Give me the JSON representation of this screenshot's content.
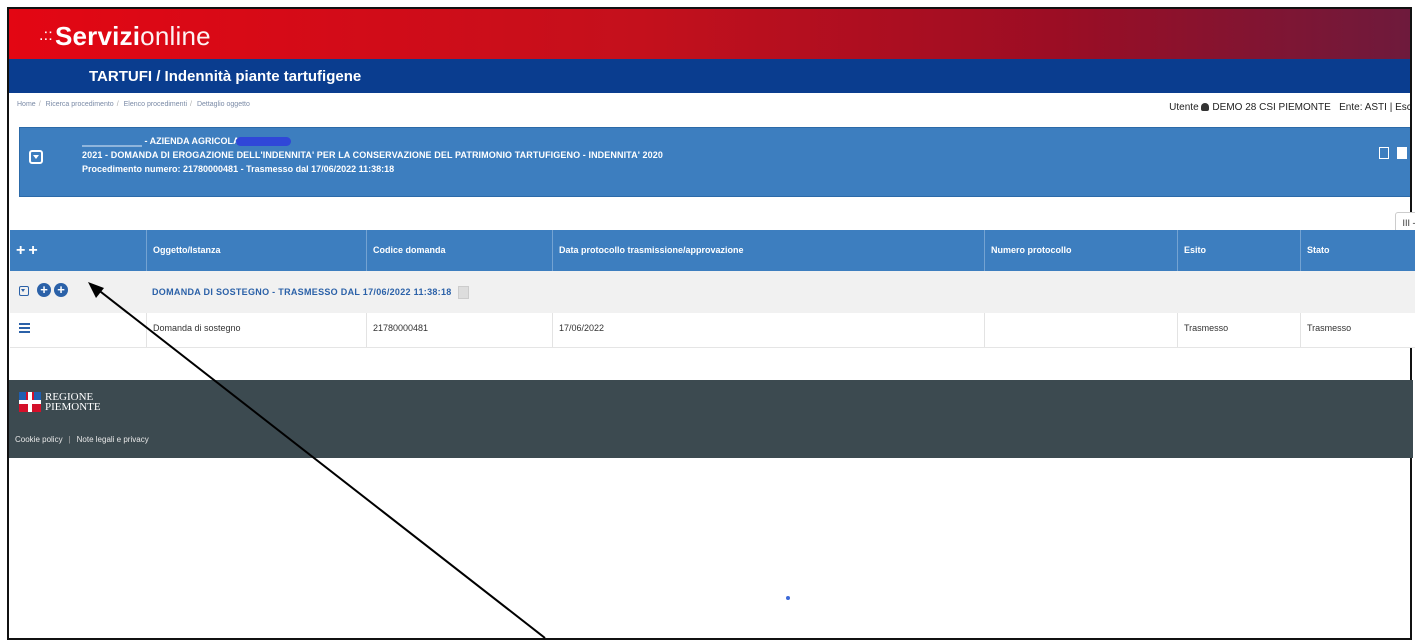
{
  "brand": {
    "dots": ".::",
    "bold": "Servizi",
    "light": "online"
  },
  "header": {
    "subtitle": "TARTUFI / Indennità piante tartufigene"
  },
  "breadcrumb": [
    "Home",
    "Ricerca procedimento",
    "Elenco procedimenti",
    "Dettaglio oggetto"
  ],
  "user": {
    "label": "Utente",
    "name": "DEMO 28 CSI PIEMONTE",
    "ente": "Ente: ASTI",
    "logout": "Esci"
  },
  "panel": {
    "line1": "- AZIENDA AGRICOLA",
    "line2": "2021 - DOMANDA DI EROGAZIONE DELL'INDENNITA' PER LA CONSERVAZIONE DEL PATRIMONIO TARTUFIGENO - INDENNITA' 2020",
    "line3": "Procedimento numero: 21780000481 - Trasmesso dal 17/06/2022 11:38:18"
  },
  "columns_button": "III -",
  "table": {
    "headers": [
      "Oggetto/Istanza",
      "Codice domanda",
      "Data protocollo trasmissione/approvazione",
      "Numero protocollo",
      "Esito",
      "Stato"
    ],
    "group_title": "DOMANDA DI SOSTEGNO - TRASMESSO DAL 17/06/2022 11:38:18",
    "rows": [
      {
        "oggetto": "Domanda di sostegno",
        "codice": "21780000481",
        "data": "17/06/2022",
        "numero": "",
        "esito": "Trasmesso",
        "stato": "Trasmesso"
      }
    ]
  },
  "footer": {
    "logo_line1": "REGIONE",
    "logo_line2": "PIEMONTE",
    "links": [
      "Cookie policy",
      "Note legali e privacy"
    ]
  },
  "colors": {
    "brand_red": "#e30613",
    "nav_blue": "#0a3d8f",
    "panel_blue": "#3d7ebf",
    "footer": "#3c4a50"
  }
}
